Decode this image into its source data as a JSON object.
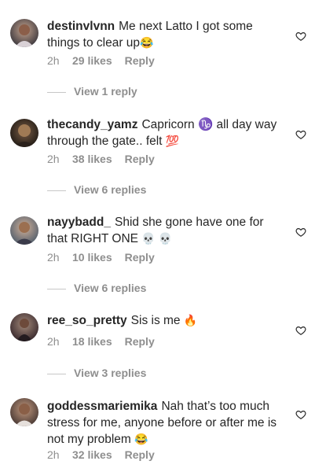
{
  "comments": [
    {
      "username": "destinvlvnn",
      "text": "Me next Latto I got some things to clear up",
      "emoji": "😂",
      "time": "2h",
      "likes": "29 likes",
      "reply": "Reply",
      "view_replies": "View 1 reply",
      "avatar_icon": "avatar-photo"
    },
    {
      "username": "thecandy_yamz",
      "text": "Capricorn ♑ all day way through the gate.. felt",
      "emoji": "💯",
      "time": "2h",
      "likes": "38 likes",
      "reply": "Reply",
      "view_replies": "View 6 replies",
      "avatar_icon": "avatar-photo"
    },
    {
      "username": "nayybadd_",
      "text": "Shid she gone have one for that RIGHT ONE",
      "emoji": "💀 💀",
      "time": "2h",
      "likes": "10 likes",
      "reply": "Reply",
      "view_replies": "View 6 replies",
      "avatar_icon": "avatar-photo"
    },
    {
      "username": "ree_so_pretty",
      "text": "Sis is me",
      "emoji": "🔥",
      "time": "2h",
      "likes": "18 likes",
      "reply": "Reply",
      "view_replies": "View 3 replies",
      "avatar_icon": "avatar-photo"
    },
    {
      "username": "goddessmariemika",
      "text": "Nah that’s too much stress for me, anyone before or after me is not my problem",
      "emoji": "😂",
      "time": "2h",
      "likes": "32 likes",
      "reply": "Reply",
      "avatar_icon": "avatar-photo"
    }
  ],
  "icons": {
    "like": "heart-outline-icon"
  },
  "colors": {
    "text": "#262626",
    "meta": "#8e8e8e",
    "divider": "#c7c7c7"
  }
}
